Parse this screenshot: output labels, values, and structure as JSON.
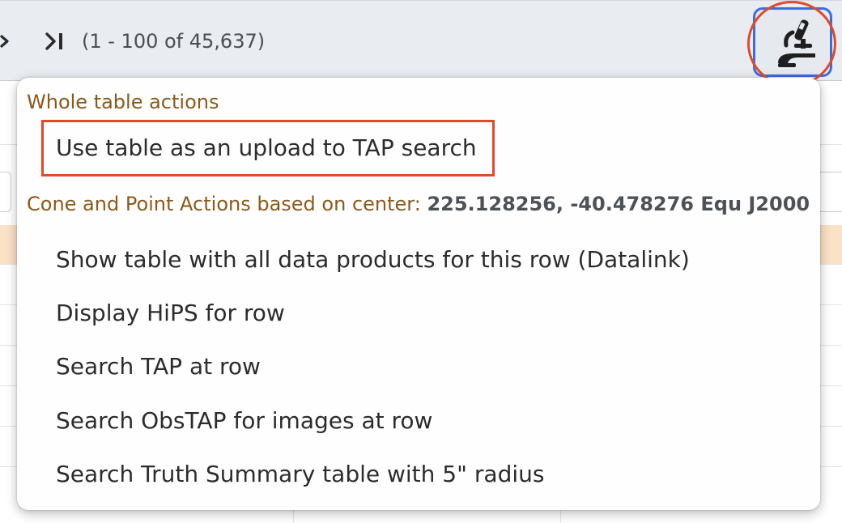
{
  "toolbar": {
    "row_count": "(1 - 100 of 45,637)",
    "icons": [
      "chevron-right-icon",
      "last-page-icon",
      "microscope-icon"
    ]
  },
  "menu": {
    "whole_table_title": "Whole table actions",
    "upload_item": "Use table as an upload to TAP search",
    "cone_title": "Cone and Point Actions based on center: ",
    "cone_center": "225.128256, -40.478276 Equ J2000",
    "items": [
      "Show table with all data products for this row (Datalink)",
      "Display HiPS for row",
      "Search TAP at row",
      "Search ObsTAP for images at row",
      "Search Truth Summary table with 5\" radius"
    ]
  },
  "colors": {
    "section_title": "#8b5a1b",
    "highlight_box": "#e04a2a",
    "button_border": "#3a6ee0",
    "row_highlight": "#fbe2c6"
  }
}
